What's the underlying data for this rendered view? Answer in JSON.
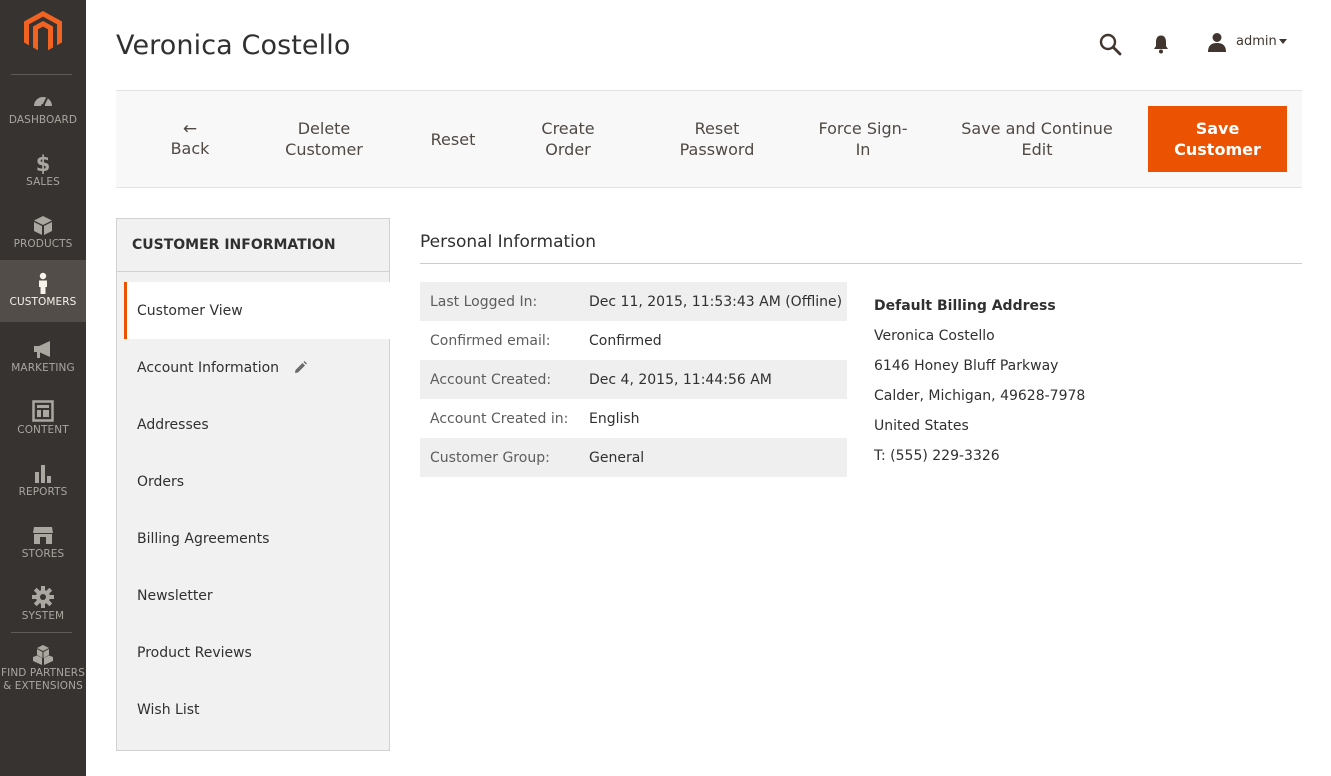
{
  "page": {
    "title": "Veronica Costello"
  },
  "header": {
    "user_name": "admin"
  },
  "sidebar": {
    "items": [
      {
        "label": "DASHBOARD",
        "icon": "dashboard-icon"
      },
      {
        "label": "SALES",
        "icon": "dollar-icon"
      },
      {
        "label": "PRODUCTS",
        "icon": "cube-icon"
      },
      {
        "label": "CUSTOMERS",
        "icon": "person-icon",
        "active": true
      },
      {
        "label": "MARKETING",
        "icon": "megaphone-icon"
      },
      {
        "label": "CONTENT",
        "icon": "layout-icon"
      },
      {
        "label": "REPORTS",
        "icon": "bar-chart-icon"
      },
      {
        "label": "STORES",
        "icon": "storefront-icon"
      },
      {
        "label": "SYSTEM",
        "icon": "gear-icon"
      },
      {
        "label_line1": "FIND PARTNERS",
        "label_line2": "& EXTENSIONS",
        "icon": "boxes-icon"
      }
    ]
  },
  "actions": {
    "back": "Back",
    "delete_1": "Delete",
    "delete_2": "Customer",
    "reset": "Reset",
    "create_1": "Create",
    "create_2": "Order",
    "resetpw_1": "Reset",
    "resetpw_2": "Password",
    "force_1": "Force Sign-",
    "force_2": "In",
    "savecont_1": "Save and Continue",
    "savecont_2": "Edit",
    "save_1": "Save",
    "save_2": "Customer"
  },
  "left_panel": {
    "title": "CUSTOMER INFORMATION",
    "tabs": [
      "Customer View",
      "Account Information",
      "Addresses",
      "Orders",
      "Billing Agreements",
      "Newsletter",
      "Product Reviews",
      "Wish List"
    ]
  },
  "personal_info": {
    "title": "Personal Information",
    "rows": [
      {
        "label": "Last Logged In:",
        "value": "Dec 11, 2015, 11:53:43 AM (Offline)"
      },
      {
        "label": "Confirmed email:",
        "value": "Confirmed"
      },
      {
        "label": "Account Created:",
        "value": "Dec 4, 2015, 11:44:56 AM"
      },
      {
        "label": "Account Created in:",
        "value": "English"
      },
      {
        "label": "Customer Group:",
        "value": "General"
      }
    ]
  },
  "billing": {
    "title": "Default Billing Address",
    "lines": [
      "Veronica Costello",
      "6146 Honey Bluff Parkway",
      "Calder, Michigan, 49628-7978",
      "United States",
      "T: (555) 229-3326"
    ]
  },
  "colors": {
    "accent": "#eb5202",
    "sidebar": "#373330",
    "sidebar_active": "#524d49"
  }
}
